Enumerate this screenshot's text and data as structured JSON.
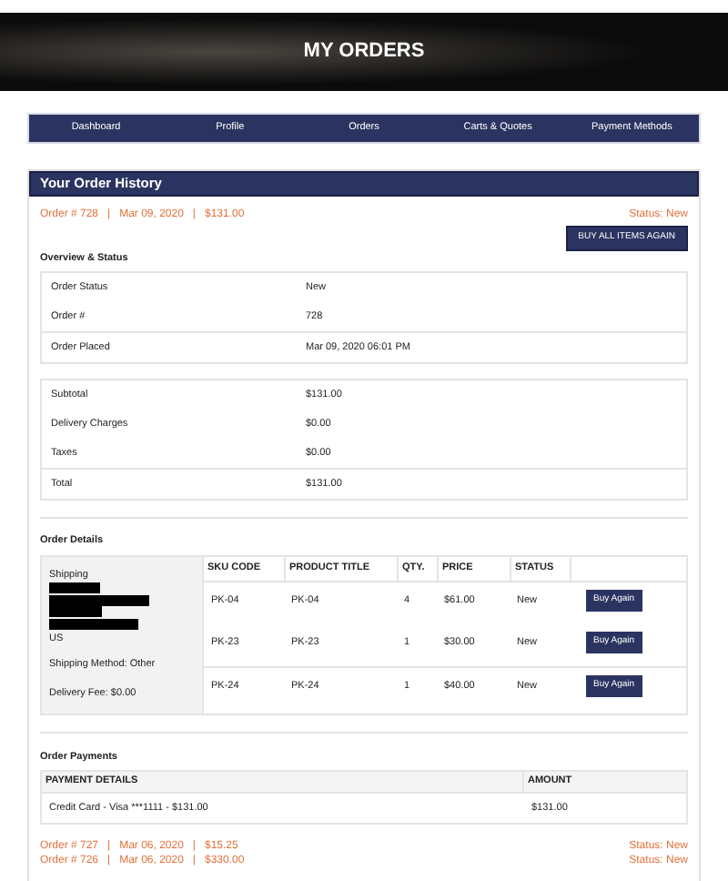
{
  "page_title": "MY ORDERS",
  "nav": [
    {
      "label": "Dashboard"
    },
    {
      "label": "Profile"
    },
    {
      "label": "Orders"
    },
    {
      "label": "Carts & Quotes"
    },
    {
      "label": "Payment Methods"
    }
  ],
  "history": {
    "title": "Your Order History",
    "current": {
      "summary": "Order # 728   |   Mar 09, 2020   |   $131.00",
      "status": "Status: New",
      "buy_all": "BUY ALL ITEMS AGAIN",
      "overview_heading": "Overview & Status",
      "overview_groups": [
        [
          {
            "label": "Order Status",
            "value": "New"
          },
          {
            "label": "Order #",
            "value": "728"
          }
        ],
        [
          {
            "label": "Order Placed",
            "value": "Mar 09, 2020 06:01 PM"
          }
        ]
      ],
      "totals_groups": [
        [
          {
            "label": "Subtotal",
            "value": "$131.00"
          },
          {
            "label": "Delivery Charges",
            "value": "$0.00"
          },
          {
            "label": "Taxes",
            "value": "$0.00"
          }
        ],
        [
          {
            "label": "Total",
            "value": "$131.00"
          }
        ]
      ],
      "details_heading": "Order Details",
      "shipping": {
        "label": "Shipping",
        "country": "US",
        "method": "Shipping Method: Other",
        "fee": "Delivery Fee: $0.00"
      },
      "columns": [
        "SKU CODE",
        "PRODUCT TITLE",
        "QTY.",
        "PRICE",
        "STATUS"
      ],
      "items": [
        {
          "sku": "PK-04",
          "title": "PK-04",
          "qty": "4",
          "price": "$61.00",
          "status": "New",
          "button": "Buy Again"
        },
        {
          "sku": "PK-23",
          "title": "PK-23",
          "qty": "1",
          "price": "$30.00",
          "status": "New",
          "button": "Buy Again"
        },
        {
          "sku": "PK-24",
          "title": "PK-24",
          "qty": "1",
          "price": "$40.00",
          "status": "New",
          "button": "Buy Again"
        }
      ],
      "payments_heading": "Order Payments",
      "payment_columns": [
        "PAYMENT DETAILS",
        "AMOUNT"
      ],
      "payments": [
        {
          "details": "Credit Card - Visa ***1111 - $131.00",
          "amount": "$131.00"
        }
      ]
    },
    "other_orders": [
      {
        "summary": "Order # 727   |   Mar 06, 2020   |   $15.25",
        "status": "Status: New"
      },
      {
        "summary": "Order # 726   |   Mar 06, 2020   |   $330.00",
        "status": "Status: New"
      }
    ]
  }
}
